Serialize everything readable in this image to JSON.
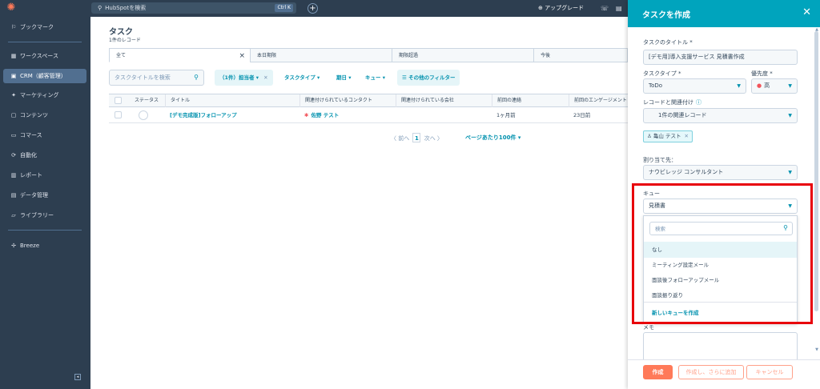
{
  "topbar": {
    "search_placeholder": "HubSpotを検索",
    "shortcut": "Ctrl K",
    "upgrade": "アップグレード"
  },
  "sidebar": {
    "items": [
      {
        "label": "ブックマーク",
        "icon": "bookmark-icon"
      },
      {
        "label": "ワークスペース",
        "icon": "workspace-icon"
      },
      {
        "label": "CRM（顧客管理）",
        "icon": "crm-icon"
      },
      {
        "label": "マーケティング",
        "icon": "marketing-icon"
      },
      {
        "label": "コンテンツ",
        "icon": "content-icon"
      },
      {
        "label": "コマース",
        "icon": "commerce-icon"
      },
      {
        "label": "自動化",
        "icon": "automation-icon"
      },
      {
        "label": "レポート",
        "icon": "report-icon"
      },
      {
        "label": "データ管理",
        "icon": "data-icon"
      },
      {
        "label": "ライブラリー",
        "icon": "library-icon"
      },
      {
        "label": "Breeze",
        "icon": "breeze-icon"
      }
    ]
  },
  "main": {
    "title": "タスク",
    "subtitle": "1件のレコード",
    "tabs": [
      "全て",
      "本日期限",
      "期限超過",
      "今後"
    ],
    "search_placeholder": "タスクタイトルを検索",
    "filters": {
      "owner": "（1件）担当者",
      "type": "タスクタイプ",
      "due": "期日",
      "queue": "キュー",
      "more": "その他のフィルター"
    },
    "columns": [
      "ステータス",
      "タイトル",
      "関連付けられているコンタクト",
      "関連付けられている会社",
      "前回の連絡",
      "前回のエンゲージメント"
    ],
    "rows": [
      {
        "title": "[デモ完成版]フォローアップ",
        "contact": "佐野 テスト",
        "company": "",
        "last_contact": "1ヶ月前",
        "last_engagement": "23日前"
      }
    ],
    "pager": {
      "prev": "前へ",
      "page": "1",
      "next": "次へ",
      "per_page": "ページあたり100件"
    }
  },
  "panel": {
    "title": "タスクを作成",
    "title_label": "タスクのタイトル",
    "title_value": "[デモ用]導入支援サービス 見積書作成",
    "type_label": "タスクタイプ",
    "type_value": "ToDo",
    "priority_label": "優先度",
    "priority_value": "高",
    "assoc_label": "レコードと関連付け",
    "assoc_value": "1件の関連レコード",
    "tag_label": "亀山 テスト",
    "assign_label": "割り当て先：",
    "assign_value": "ナウビレッジ コンサルタント",
    "queue_label": "キュー",
    "queue_value": "見積書",
    "dropdown": {
      "search_placeholder": "検索",
      "options": [
        "なし",
        "ミーティング設定メール",
        "面談後フォローアップメール",
        "面談振り返り"
      ],
      "create": "新しいキューを作成"
    },
    "memo_label": "メモ",
    "buttons": {
      "create": "作成",
      "create_add": "作成し、さらに追加",
      "cancel": "キャンセル"
    }
  }
}
